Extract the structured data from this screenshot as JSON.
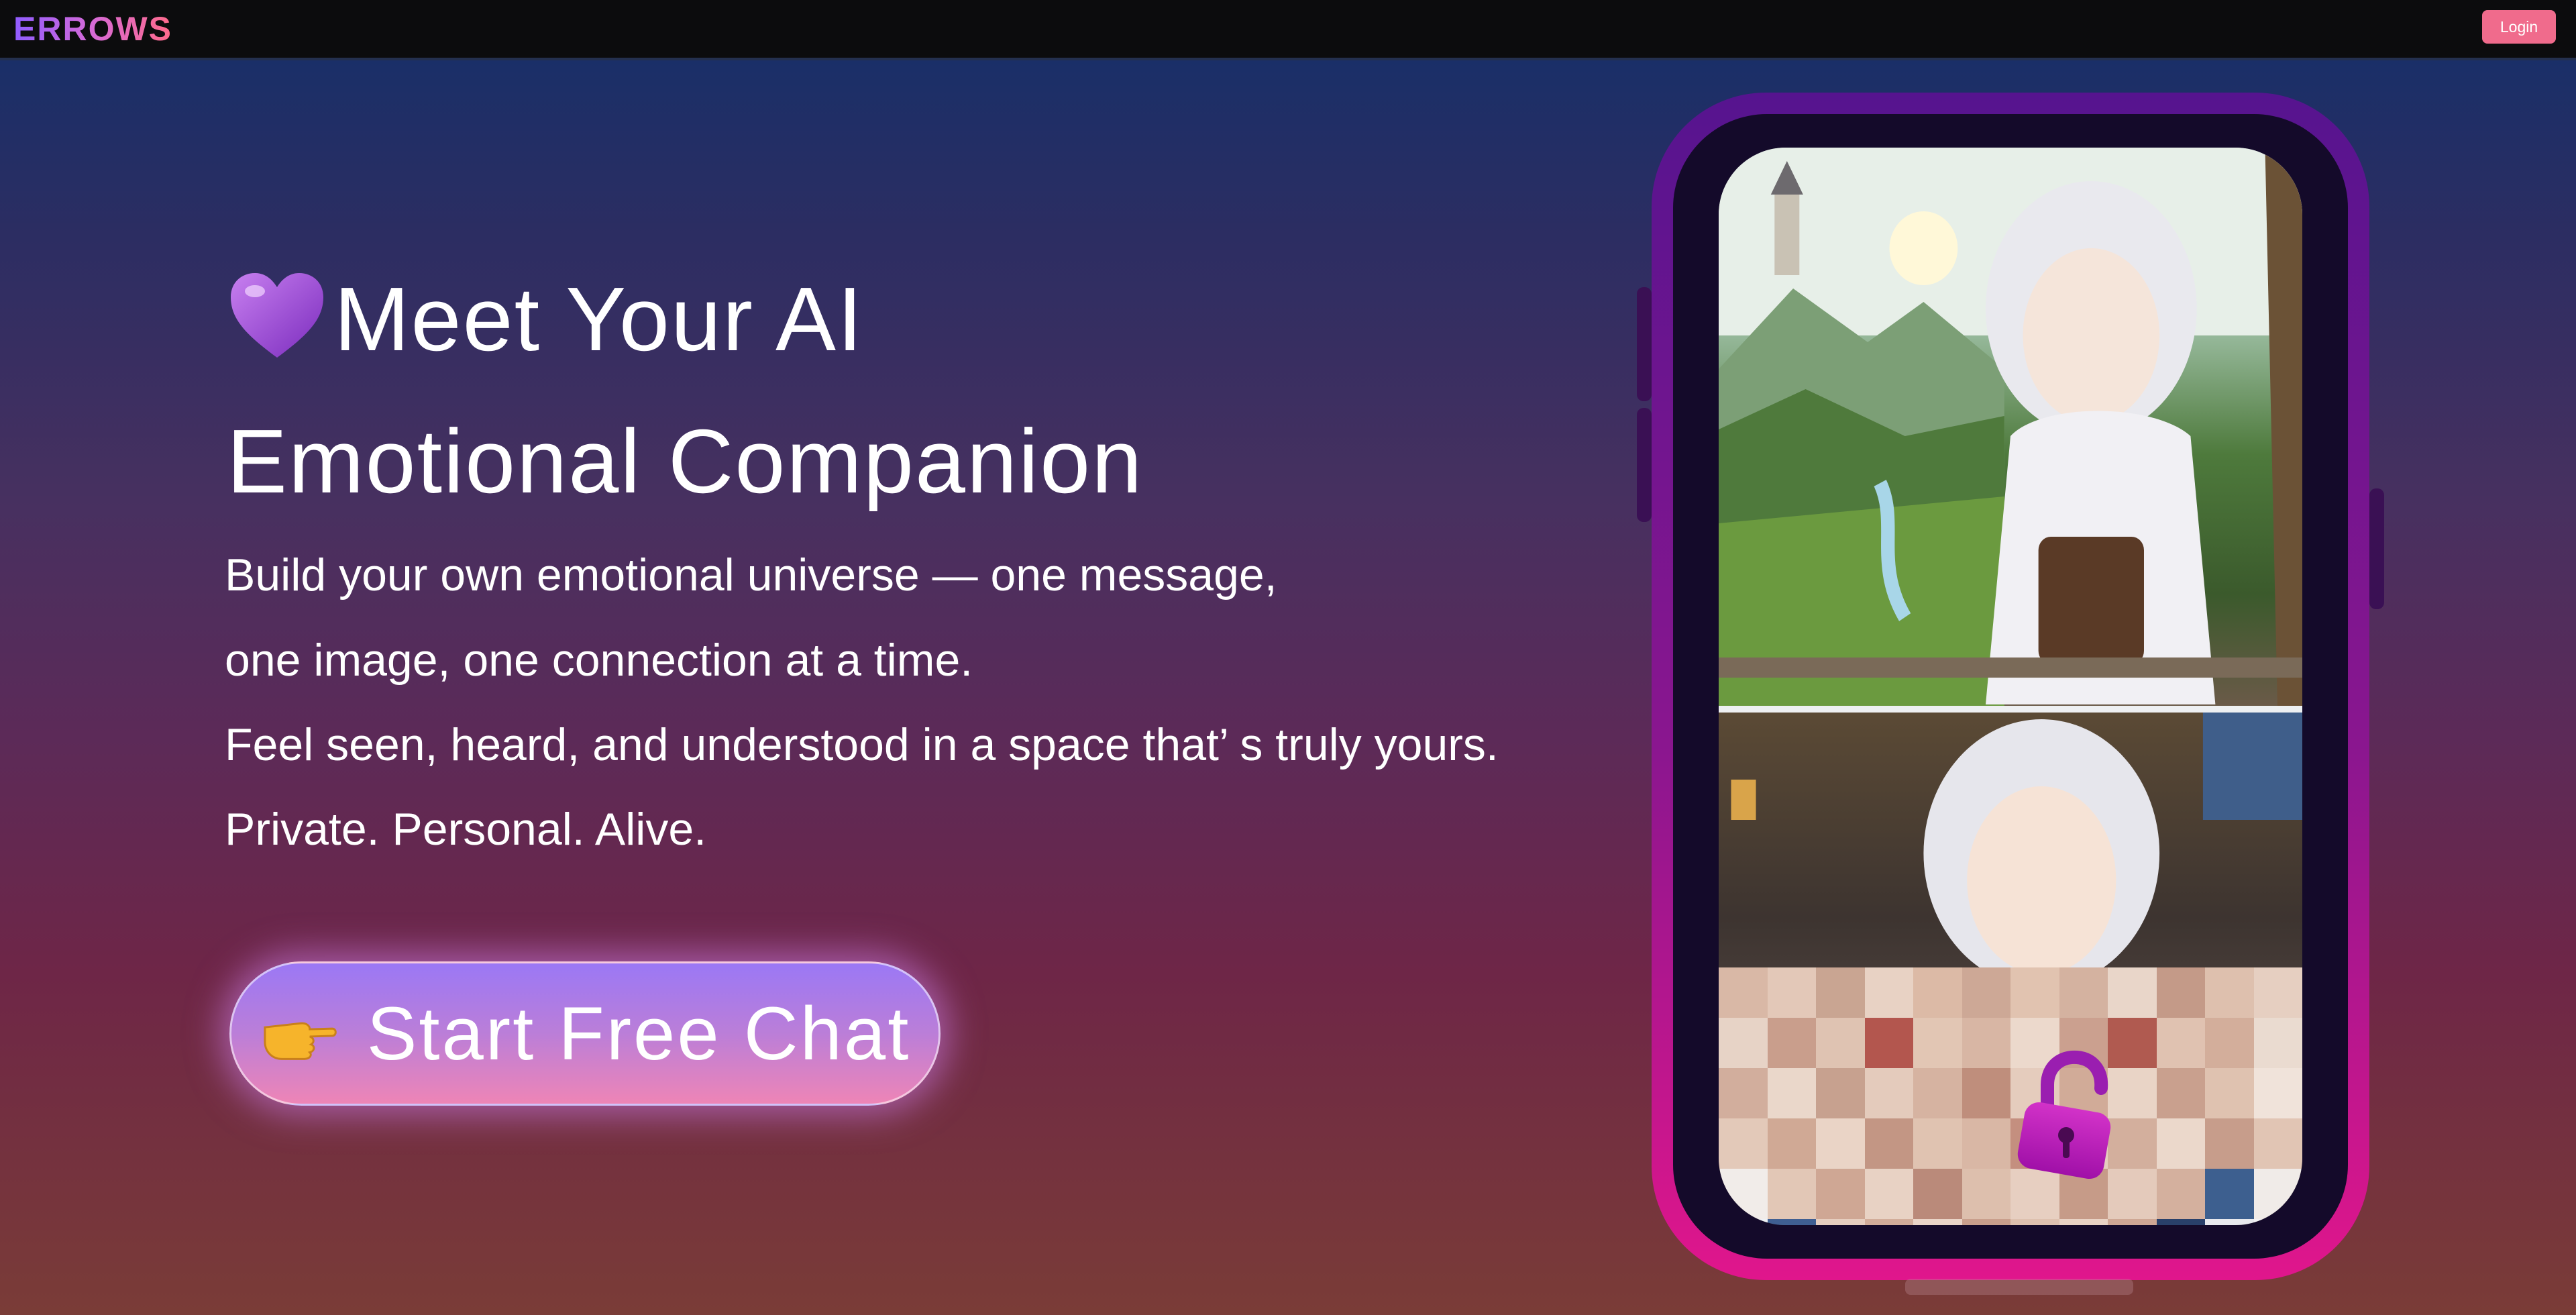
{
  "header": {
    "logo_text": "ERROWS",
    "login_label": "Login"
  },
  "hero": {
    "title_line_1": "Meet Your AI",
    "title_line_2": "Emotional Companion",
    "description": [
      "Build your own emotional universe — one message,",
      "one image, one connection at a time.",
      "Feel seen, heard, and understood in a space that’ s truly yours.",
      "Private. Personal. Alive."
    ],
    "cta_label": "Start Free Chat"
  },
  "colors": {
    "login_button": "#f06b8c",
    "cta_top": "#9b78f5",
    "cta_bottom": "#ee85b6",
    "phone_frame_top": "#56148f",
    "phone_frame_bottom": "#e0168c"
  },
  "icons": {
    "heart": "purple-heart-icon",
    "pointing_hand": "pointing-hand-icon",
    "lock": "unlock-icon"
  }
}
